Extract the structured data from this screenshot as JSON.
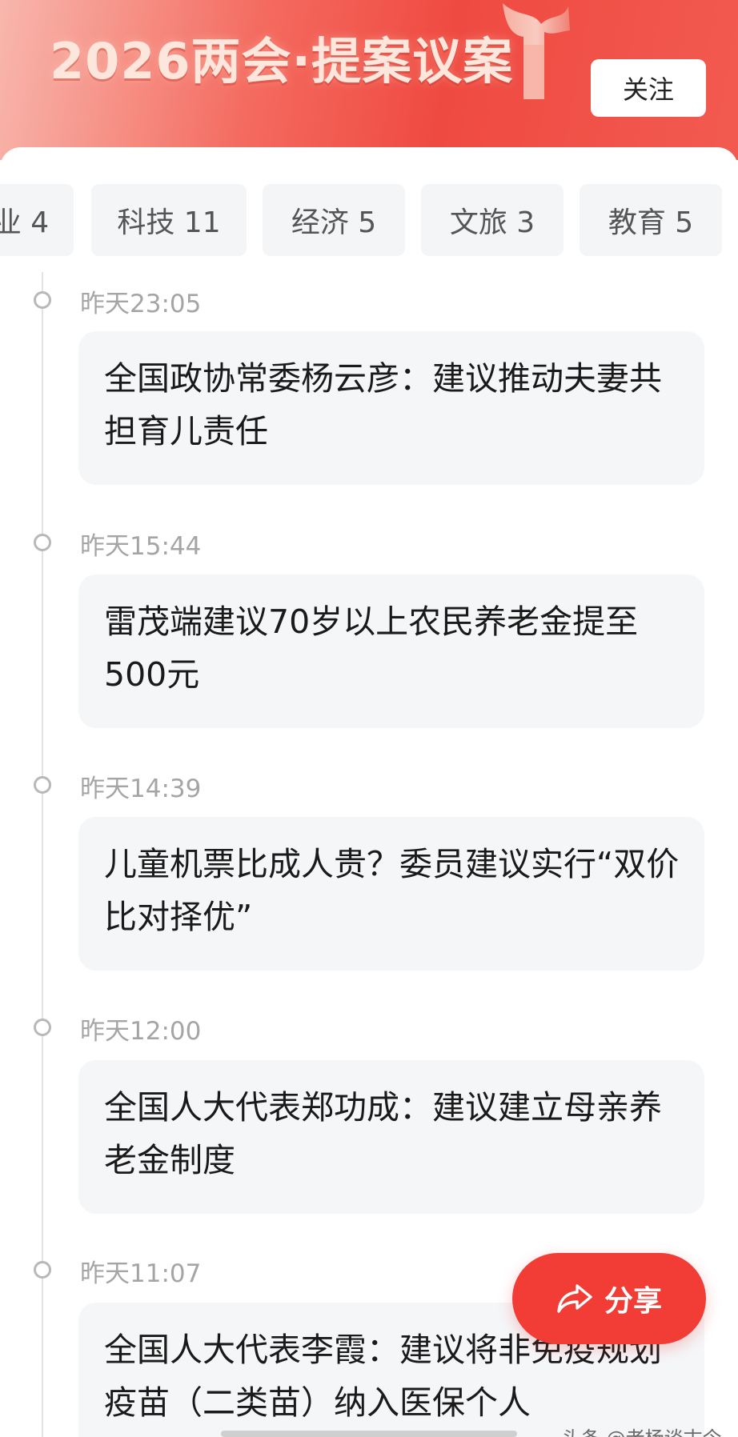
{
  "header": {
    "title": "2026两会·提案议案",
    "follow_label": "关注"
  },
  "tabs": [
    {
      "label": "业 4"
    },
    {
      "label": "科技 11"
    },
    {
      "label": "经济 5"
    },
    {
      "label": "文旅 3"
    },
    {
      "label": "教育 5"
    }
  ],
  "timeline": [
    {
      "time": "昨天23:05",
      "headline": "全国政协常委杨云彦：建议推动夫妻共担育儿责任"
    },
    {
      "time": "昨天15:44",
      "headline": "雷茂端建议70岁以上农民养老金提至500元"
    },
    {
      "time": "昨天14:39",
      "headline": "儿童机票比成人贵？委员建议实行“双价比对择优”"
    },
    {
      "time": "昨天12:00",
      "headline": "全国人大代表郑功成：建议建立母亲养老金制度"
    },
    {
      "time": "昨天11:07",
      "headline": "全国人大代表李霞：建议将非免疫规划疫苗（二类苗）纳入医保个人"
    }
  ],
  "share": {
    "label": "分享",
    "icon": "share-arrow-icon"
  },
  "watermark": "头条 @老杨谈古今",
  "colors": {
    "accent": "#f23d37",
    "banner_start": "#f8b7ad",
    "banner_end": "#ef4a41",
    "card_bg": "#f5f6f8"
  }
}
